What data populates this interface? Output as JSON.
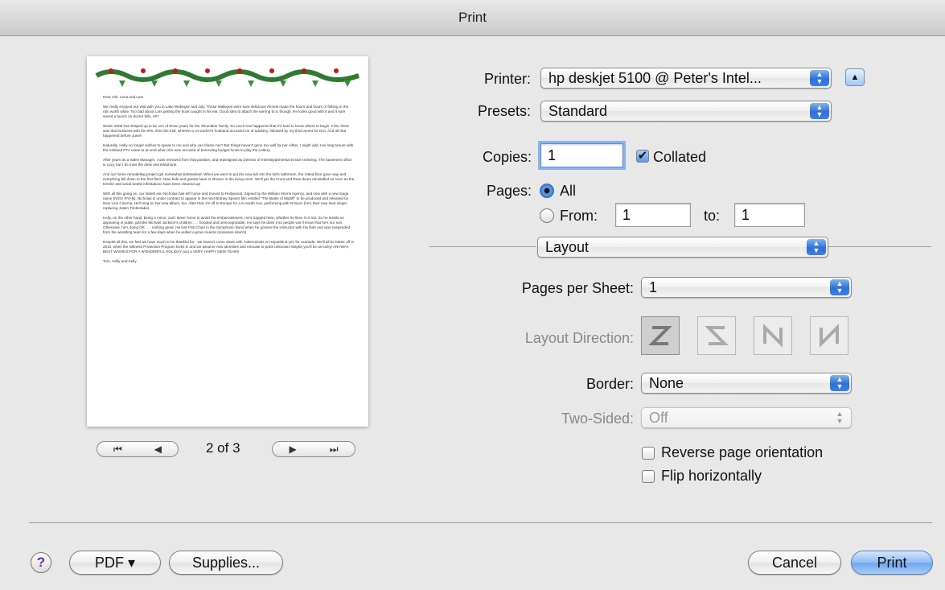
{
  "window": {
    "title": "Print"
  },
  "preview": {
    "page_indicator": "2 of 3",
    "letter_paragraphs": [
      "Dear Ole, Lena and Lars",
      "We really enjoyed our visit with you in Lake Wobegon last July. Those Walleyes were sure delicious! Almost made the hours and hours of fishing in the rain worth while. Too bad about Lars getting the hook caught in his ear. Good idea to attach the earring to it, though. He looks good with it and it sure saved a bunch on doctor bills, eh?",
      "Wow!! 2009 has shaped up to be one of those years for the Shumaker family. So much has happened that it's hard to know where to begin. First, there was that business with the IRS, then the trial, wherein a co-worker's husband accused me of adultery, followed by my third arrest for DUI. And all that happened before June!!",
      "Naturally, Holly no longer wishes to speak to me and who can blame her? But things haven't gone too well for her either, I might add. Her long tenure with the Ashland PTA came to an end when she was accused of borrowing budget funds to play the Lottery.",
      "After years as a Sales Manager, I was removed from that position, and reassigned as Director of Interdepartmental Email Archiving. The basement office is cozy, but I do miss the desk and telephone.",
      "And our home remodeling project got somewhat sidetracked. When we went to put the new tub into the kid's bathroom, the rotted floor gave way and everything fell down to the first floor. Now, kids and guests have to shower in the living room. We'll get the Front and Rear doors reinstalled as soon as the termite and wood beetle infestations have been cleaned up!",
      "With all this going on, our oldest son Nicholas has left home and moved to Hollywood. Signed by the William Morris Agency, and now with a new stage name (NICK RYAN), Nicholas is under contract to appear in the next Britney Spears film entitled \"The Battle of Midriff\" to be produced and released by New Line Cinema. He'll sing on her new album, too. After that, it's off to Europe for a 6 month tour, performing with N*Sync (he's their new lead singer, replacing Justin Timberlake).",
      "Kelly, on the other hand, being a minor, can't leave home to avoid the embarrassment. He's trapped here, whether he likes it or not. So he insists on appearing in public just like Michael Jackson's children . . . hooded and unrecognizable. He says he does it so people won't know that he's our son. Otherwise, he's doing OK . . . nothing great. He lost First Chair in the Symphonic Band when he goosed the instructor with his flute and was suspended from the wrestling team for a few days when he pulled a groin muscle (someone else's!)",
      "Despite all this, we feel we have much to be thankful for - we haven't come down with Tuberculosis or Hepatitis B yet, for example. We'll all be better off in 2010, when the Witness Protection Program kicks in and we assume new identities and relocate to parts unknown! Maybe you'll be as lucky! ANYWAY, BEST WISHES FOR A WONDERFUL HOLIDAY and a VERY HAPPY NEW YEAR!!",
      "Tom, Holly and Kelly"
    ]
  },
  "printer": {
    "label": "Printer:",
    "value": "hp deskjet 5100 @ Peter's Intel..."
  },
  "presets": {
    "label": "Presets:",
    "value": "Standard"
  },
  "copies": {
    "label": "Copies:",
    "value": "1",
    "collated_label": "Collated",
    "collated": true
  },
  "pages": {
    "label": "Pages:",
    "all_label": "All",
    "from_label": "From:",
    "to_label": "to:",
    "from_value": "1",
    "to_value": "1",
    "selected": "All"
  },
  "section_popup": {
    "value": "Layout"
  },
  "layout": {
    "pages_per_sheet_label": "Pages per Sheet:",
    "pages_per_sheet_value": "1",
    "direction_label": "Layout Direction:",
    "border_label": "Border:",
    "border_value": "None",
    "two_sided_label": "Two-Sided:",
    "two_sided_value": "Off",
    "reverse_label": "Reverse page orientation",
    "flip_label": "Flip horizontally"
  },
  "buttons": {
    "help": "?",
    "pdf": "PDF ▾",
    "supplies": "Supplies...",
    "cancel": "Cancel",
    "print": "Print"
  },
  "colors": {
    "accent": "#3b82ea",
    "default_button": "#8fbaf2",
    "help_icon": "#6a2ca0"
  }
}
